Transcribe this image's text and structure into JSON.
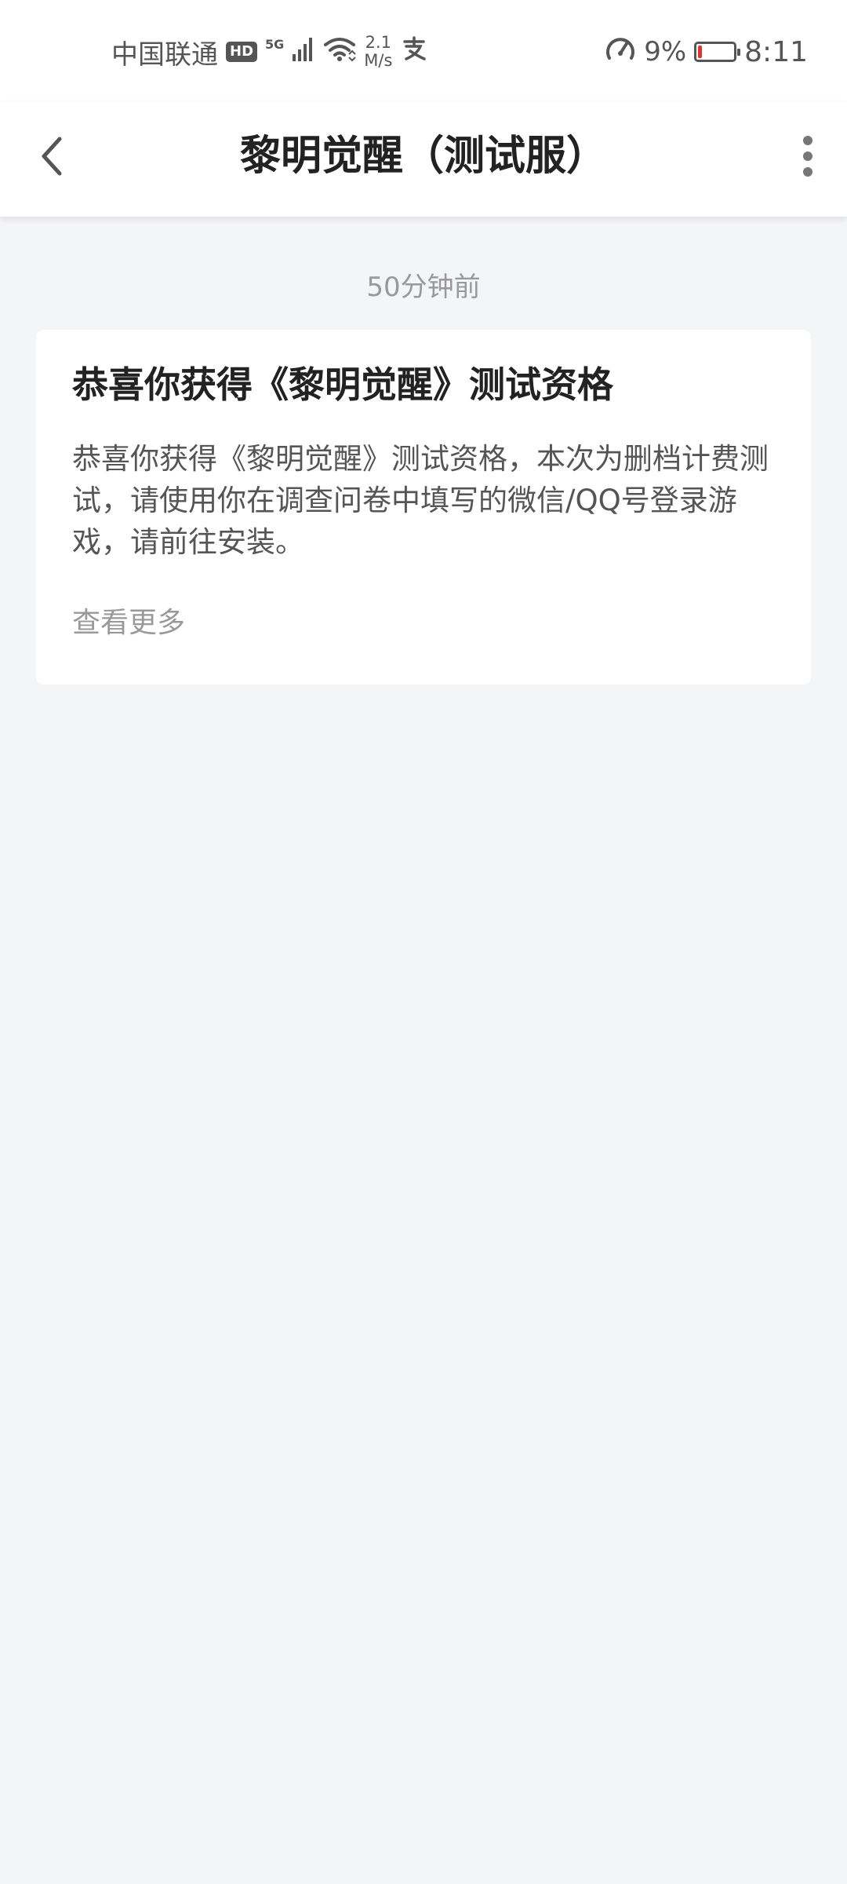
{
  "status_bar": {
    "carrier": "中国联通",
    "hd": "HD",
    "network": "5G",
    "speed_value": "2.1",
    "speed_unit": "M/s",
    "battery_percent": "9%",
    "battery_level": 0.09,
    "time": "8:11",
    "icons": [
      "signal-icon",
      "wifi-icon",
      "alipay-icon",
      "speedometer-icon",
      "battery-icon"
    ]
  },
  "header": {
    "title": "黎明觉醒（测试服）",
    "back_icon": "chevron-left-icon",
    "more_icon": "more-vertical-icon"
  },
  "message": {
    "timestamp": "50分钟前",
    "title": "恭喜你获得《黎明觉醒》测试资格",
    "body": "恭喜你获得《黎明觉醒》测试资格，本次为删档计费测试，请使用你在调查问卷中填写的微信/QQ号登录游戏，请前往安装。",
    "more_label": "查看更多"
  },
  "colors": {
    "background": "#f4f5f7",
    "card": "#ffffff",
    "title_text": "#222222",
    "body_text": "#555555",
    "muted_text": "#999999",
    "battery_low": "#e0332d"
  }
}
